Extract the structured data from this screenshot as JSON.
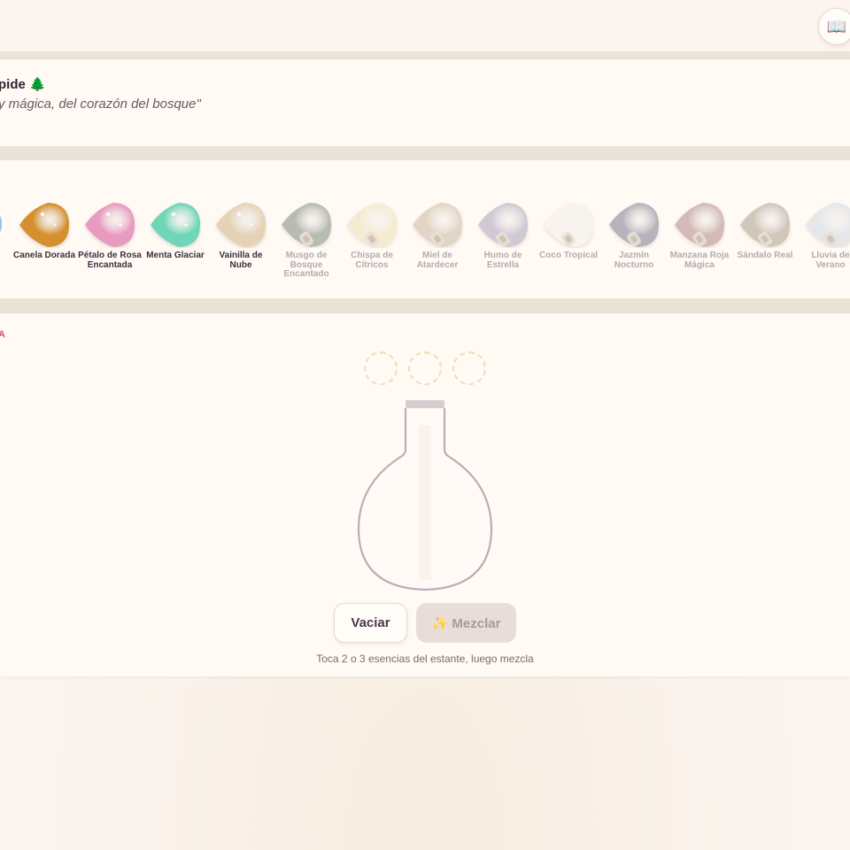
{
  "header": {
    "book_icon": "📖"
  },
  "recipe": {
    "title": "pide 🌲",
    "quote": "y mágica, del corazón del bosque\""
  },
  "shelf": {
    "essences": [
      {
        "name": "Canela Dorada",
        "color": "#d4902e",
        "locked": false
      },
      {
        "name": "Pétalo de Rosa Encantada",
        "color": "#e89ac0",
        "locked": false
      },
      {
        "name": "Menta Glaciar",
        "color": "#6fd6b8",
        "locked": false
      },
      {
        "name": "Vainilla de Nube",
        "color": "#e6d3b6",
        "locked": false
      },
      {
        "name": "Musgo de Bosque Encantado",
        "color": "#a4aaa0",
        "locked": true
      },
      {
        "name": "Chispa de Cítricos",
        "color": "#f3e8c8",
        "locked": true
      },
      {
        "name": "Miel de Atardecer",
        "color": "#dccbb8",
        "locked": true
      },
      {
        "name": "Humo de Estrella",
        "color": "#c4bccc",
        "locked": true
      },
      {
        "name": "Coco Tropical",
        "color": "#f7f2ea",
        "locked": true
      },
      {
        "name": "Jazmín Nocturno",
        "color": "#a49eac",
        "locked": true
      },
      {
        "name": "Manzana Roja Mágica",
        "color": "#c8a8a6",
        "locked": true
      },
      {
        "name": "Sándalo Real",
        "color": "#c4b8aa",
        "locked": true
      },
      {
        "name": "Lluvia de Verano",
        "color": "#dee2e6",
        "locked": true
      }
    ]
  },
  "mixer": {
    "label": "A",
    "slots": 3,
    "empty_label": "Vaciar",
    "mix_label": "✨ Mezclar",
    "hint": "Toca 2 o 3 esencias del estante, luego mezcla"
  },
  "colors": {
    "accent": "#d2507a",
    "flask_outline": "#b9aeb8",
    "flask_cap": "#d6ccd2",
    "slot_border": "#eadfb8"
  }
}
